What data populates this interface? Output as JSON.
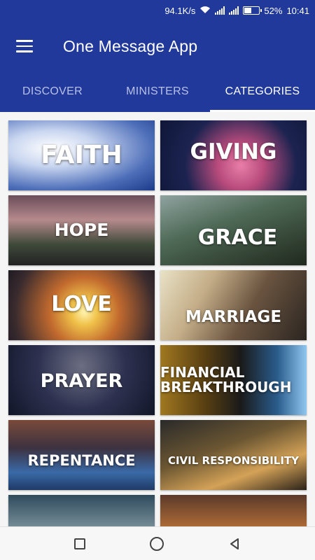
{
  "status": {
    "speed": "94.1K/s",
    "battery": "52%",
    "battery_level": 0.52,
    "time": "10:41"
  },
  "appbar": {
    "title": "One Message App",
    "menu_icon": "hamburger-menu-icon"
  },
  "tabs": [
    {
      "label": "DISCOVER",
      "active": false
    },
    {
      "label": "MINISTERS",
      "active": false
    },
    {
      "label": "CATEGORIES",
      "active": true
    }
  ],
  "categories": [
    {
      "label": "FAITH"
    },
    {
      "label": "GIVING"
    },
    {
      "label": "HOPE"
    },
    {
      "label": "GRACE"
    },
    {
      "label": "LOVE"
    },
    {
      "label": "MARRIAGE"
    },
    {
      "label": "PRAYER"
    },
    {
      "label": "FINANCIAL BREAKTHROUGH"
    },
    {
      "label": "REPENTANCE"
    },
    {
      "label": "CIVIL RESPONSIBILITY"
    },
    {
      "label": ""
    },
    {
      "label": ""
    }
  ],
  "colors": {
    "primary": "#21399a",
    "tab_inactive": "#b8c0e6"
  }
}
